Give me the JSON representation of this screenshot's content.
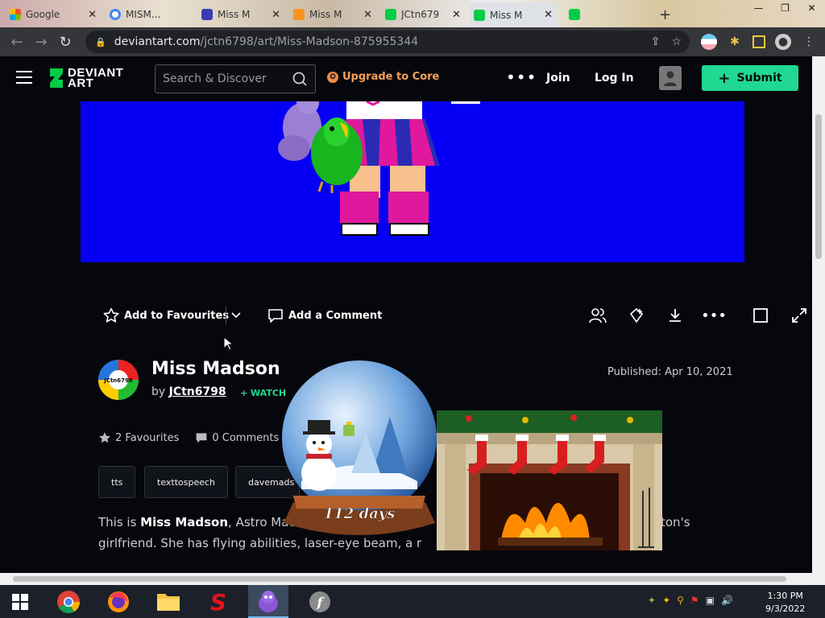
{
  "browser": {
    "tabs": [
      {
        "title": "Google",
        "favicon_color": "#e94235",
        "active": false
      },
      {
        "title": "MISM...",
        "favicon_color": "#4285f4",
        "active": false
      },
      {
        "title": "Miss M",
        "favicon_color": "#3b3bb5",
        "active": false
      },
      {
        "title": "Miss M",
        "favicon_color": "#f7931e",
        "active": false
      },
      {
        "title": "JCtn679",
        "favicon_color": "#05cc47",
        "active": false
      },
      {
        "title": "Miss M",
        "favicon_color": "#05cc47",
        "active": true
      },
      {
        "title": "",
        "favicon_color": "#05cc47",
        "active": false
      }
    ],
    "new_tab": "+",
    "url_host": "deviantart.com",
    "url_path": "/jctn6798/art/Miss-Madson-875955344"
  },
  "header": {
    "logo_text": [
      "DEVIANT",
      "ART"
    ],
    "search_placeholder": "Search & Discover",
    "upgrade_label": "Upgrade to Core",
    "more_label": "•••",
    "join_label": "Join",
    "login_label": "Log In",
    "submit_label": "Submit"
  },
  "actions": {
    "favourite_label": "Add to Favourites",
    "comment_label": "Add a Comment"
  },
  "deviation": {
    "title": "Miss Madson",
    "by_prefix": "by",
    "author": "JCtn6798",
    "watch_label": "+ WATCH",
    "published": "Published: Apr 10, 2021",
    "favourites": "2 Favourites",
    "comments": "0 Comments",
    "tags": [
      "tts",
      "texttospeech",
      "davemads"
    ],
    "desc_start": "This is ",
    "desc_name": "Miss Madson",
    "desc_mid": ", Astro Mac",
    "desc_right": "ton's",
    "desc_line2": "girlfriend. She has flying abilities, laser-eye beam, a r",
    "avatar_text": "JCtn6798"
  },
  "overlay": {
    "globe_caption": "112 days"
  },
  "taskbar": {
    "apps": [
      "windows-start",
      "chrome",
      "firefox",
      "file-explorer",
      "sonic",
      "bonzi",
      "flash"
    ],
    "time": "1:30 PM",
    "date": "9/3/2022"
  }
}
